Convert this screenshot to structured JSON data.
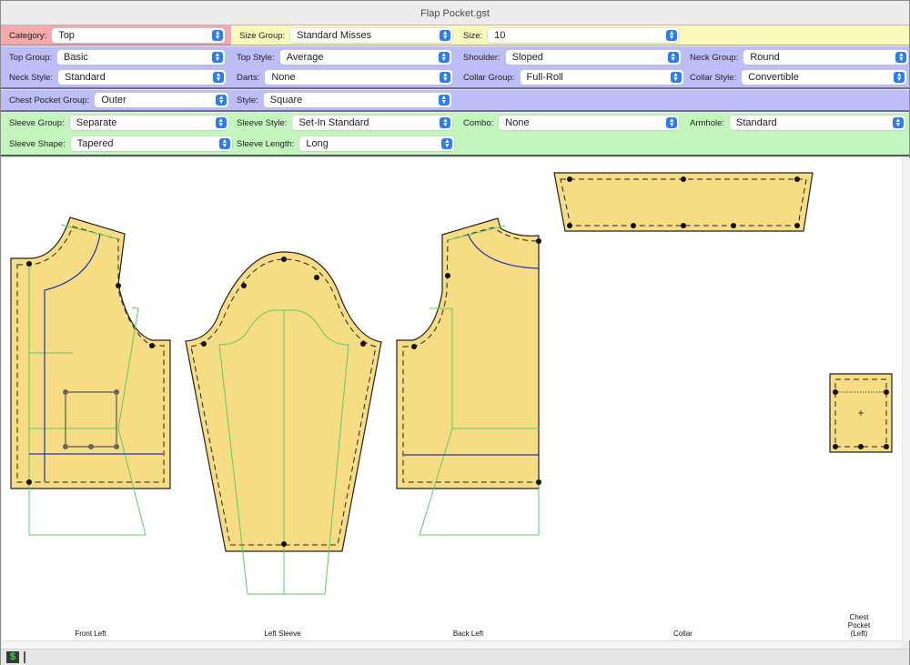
{
  "window": {
    "title": "Flap Pocket.gst"
  },
  "colors": {
    "category_band": "#f4a9ab",
    "size_band": "#fbf8bc",
    "top_band": "#bdbdf8",
    "sleeve_band": "#c2f6bc",
    "piece_fill": "#f6dc82",
    "guide_green": "#63c76a",
    "guide_blue": "#2233bb",
    "select_arrow": "#2b7df6"
  },
  "controls": {
    "category": {
      "label": "Category:",
      "value": "Top"
    },
    "size_group": {
      "label": "Size Group:",
      "value": "Standard Misses"
    },
    "size": {
      "label": "Size:",
      "value": "10"
    },
    "top_group": {
      "label": "Top Group:",
      "value": "Basic"
    },
    "top_style": {
      "label": "Top Style:",
      "value": "Average"
    },
    "shoulder": {
      "label": "Shoulder:",
      "value": "Sloped"
    },
    "neck_group": {
      "label": "Neck Group:",
      "value": "Round"
    },
    "neck_style": {
      "label": "Neck Style:",
      "value": "Standard"
    },
    "darts": {
      "label": "Darts:",
      "value": "None"
    },
    "collar_group": {
      "label": "Collar Group:",
      "value": "Full-Roll"
    },
    "collar_style": {
      "label": "Collar Style:",
      "value": "Convertible"
    },
    "chest_pocket_group": {
      "label": "Chest Pocket Group:",
      "value": "Outer"
    },
    "style": {
      "label": "Style:",
      "value": "Square"
    },
    "sleeve_group": {
      "label": "Sleeve Group:",
      "value": "Separate"
    },
    "sleeve_style": {
      "label": "Sleeve Style:",
      "value": "Set-In Standard"
    },
    "combo": {
      "label": "Combo:",
      "value": "None"
    },
    "armhole": {
      "label": "Armhole:",
      "value": "Standard"
    },
    "sleeve_shape": {
      "label": "Sleeve Shape:",
      "value": "Tapered"
    },
    "sleeve_length": {
      "label": "Sleeve Length:",
      "value": "Long"
    }
  },
  "pieces": [
    {
      "name": "Front Left"
    },
    {
      "name": "Left Sleeve"
    },
    {
      "name": "Back Left"
    },
    {
      "name": "Collar"
    },
    {
      "name": "Chest Pocket (Left)",
      "lines": [
        "Chest",
        "Pocket",
        "(Left)"
      ]
    }
  ],
  "status": {
    "icon": "dollar-sign-icon",
    "glyph": "$"
  }
}
